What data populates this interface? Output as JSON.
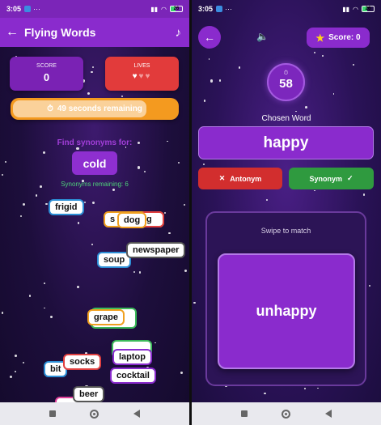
{
  "status_bar": {
    "time": "3:05",
    "dots": "···",
    "battery": "26"
  },
  "left": {
    "app_title": "Flying Words",
    "back_icon": "arrow-left-icon",
    "music_icon": "music-note-icon",
    "score": {
      "label": "SCORE",
      "value": "0"
    },
    "lives": {
      "label": "LIVES",
      "total": 3,
      "remaining": 1
    },
    "timer": {
      "text": "49 seconds remaining",
      "progress": 0.82
    },
    "prompt": "Find synonyms for:",
    "target_word": "cold",
    "remaining_text": "Synonyms remaining: 6",
    "falling_words": [
      {
        "text": "frigid",
        "border": "#2d8fd6"
      },
      {
        "text": "s",
        "border": "#f0a020"
      },
      {
        "text": "dog",
        "border": "#f0a020"
      },
      {
        "text": "g",
        "border": "#e04040"
      },
      {
        "text": "soup",
        "border": "#2d8fd6"
      },
      {
        "text": "newspaper",
        "border": "#555555"
      },
      {
        "text": "grape",
        "border": "#f0a020"
      },
      {
        "text": "",
        "border": "#3cba5a"
      },
      {
        "text": "laptop",
        "border": "#8a2bcd"
      },
      {
        "text": "bit",
        "border": "#2d8fd6"
      },
      {
        "text": "socks",
        "border": "#e04040"
      },
      {
        "text": "cocktail",
        "border": "#8a2bcd"
      },
      {
        "text": "beer",
        "border": "#555555"
      },
      {
        "text": "",
        "border": "#e0409a"
      }
    ]
  },
  "right": {
    "back_icon": "arrow-left-icon",
    "sound_icon": "speaker-icon",
    "score_label": "Score: 0",
    "score_icon": "star-icon",
    "countdown": "58",
    "chosen_label": "Chosen Word",
    "chosen_word": "happy",
    "antonym_label": "Antonym",
    "synonym_label": "Synonym",
    "swipe_label": "Swipe to match",
    "card_word": "unhappy"
  },
  "colors": {
    "purple": "#8a2bcd",
    "red": "#d22e2e",
    "green": "#2f9a3f",
    "orange": "#f49a1f"
  }
}
